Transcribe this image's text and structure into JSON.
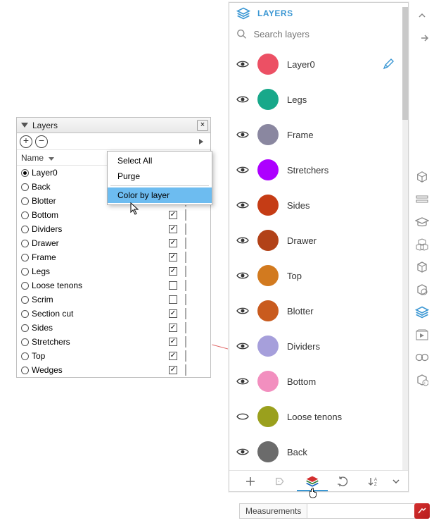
{
  "desktop": {
    "title": "Layers",
    "columns": {
      "name": "Name"
    },
    "menu": {
      "select_all": "Select All",
      "purge": "Purge",
      "color_by_layer": "Color by layer"
    },
    "rows": [
      {
        "name": "Layer0",
        "selected": true,
        "visible": true,
        "color": "#ffffff"
      },
      {
        "name": "Back",
        "selected": false,
        "visible": true,
        "color": "#6b6b6b"
      },
      {
        "name": "Blotter",
        "selected": false,
        "visible": true,
        "color": "#c95b1e"
      },
      {
        "name": "Bottom",
        "selected": false,
        "visible": true,
        "color": "#ec8fbf"
      },
      {
        "name": "Dividers",
        "selected": false,
        "visible": true,
        "color": "#9e97d0"
      },
      {
        "name": "Drawer",
        "selected": false,
        "visible": true,
        "color": "#a83a18"
      },
      {
        "name": "Frame",
        "selected": false,
        "visible": true,
        "color": "#807f85"
      },
      {
        "name": "Legs",
        "selected": false,
        "visible": true,
        "color": "#0aa27a"
      },
      {
        "name": "Loose tenons",
        "selected": false,
        "visible": false,
        "color": "#8a8f1b"
      },
      {
        "name": "Scrim",
        "selected": false,
        "visible": false,
        "color": "#c89ee0"
      },
      {
        "name": "Section cut",
        "selected": false,
        "visible": true,
        "color": "#f0a436"
      },
      {
        "name": "Sides",
        "selected": false,
        "visible": true,
        "color": "#bd3612"
      },
      {
        "name": "Stretchers",
        "selected": false,
        "visible": true,
        "color": "#a100ff"
      },
      {
        "name": "Top",
        "selected": false,
        "visible": true,
        "color": "#bc6b17"
      },
      {
        "name": "Wedges",
        "selected": false,
        "visible": true,
        "color": "#4b1f7a"
      }
    ]
  },
  "web": {
    "title": "LAYERS",
    "search_placeholder": "Search layers",
    "rows": [
      {
        "name": "Layer0",
        "visible": true,
        "color": "#ec5064",
        "editing": true
      },
      {
        "name": "Legs",
        "visible": true,
        "color": "#18a88a"
      },
      {
        "name": "Frame",
        "visible": true,
        "color": "#8a87a0"
      },
      {
        "name": "Stretchers",
        "visible": true,
        "color": "#ad00ff"
      },
      {
        "name": "Sides",
        "visible": true,
        "color": "#c53c15"
      },
      {
        "name": "Drawer",
        "visible": true,
        "color": "#b24218"
      },
      {
        "name": "Top",
        "visible": true,
        "color": "#d27a1f"
      },
      {
        "name": "Blotter",
        "visible": true,
        "color": "#c95b1e"
      },
      {
        "name": "Dividers",
        "visible": true,
        "color": "#a69fdb"
      },
      {
        "name": "Bottom",
        "visible": true,
        "color": "#f28fbf"
      },
      {
        "name": "Loose tenons",
        "visible": false,
        "color": "#9aa01d"
      },
      {
        "name": "Back",
        "visible": true,
        "color": "#6b6b6b"
      }
    ]
  },
  "measurements": {
    "label": "Measurements"
  }
}
